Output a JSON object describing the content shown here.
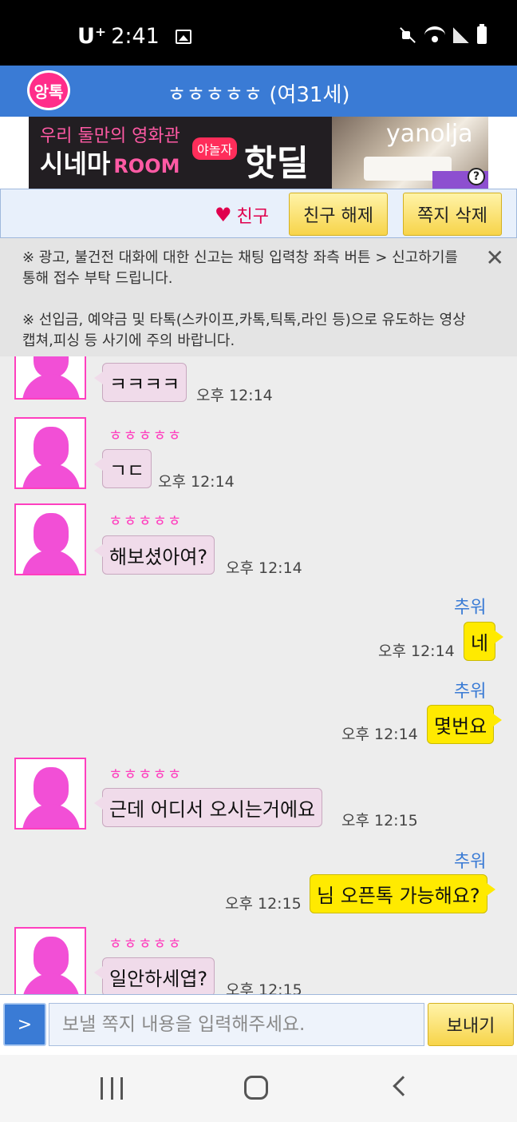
{
  "status_bar": {
    "carrier": "U⁺",
    "time": "2:41"
  },
  "header": {
    "logo": "앙톡",
    "title": "ㅎㅎㅎㅎㅎ (여31세)"
  },
  "banner": {
    "line1": "우리 둘만의 영화관",
    "line2": "시네마",
    "line2_room": "ROOM",
    "tag": "야놀자",
    "deal": "핫딜",
    "brand": "yanolja",
    "help": "?"
  },
  "actions": {
    "friend_label": "친구",
    "unfriend": "친구 해제",
    "delete_note": "쪽지 삭제"
  },
  "notice": {
    "p1": "※ 광고, 불건전 대화에 대한 신고는 채팅 입력창 좌측 버튼 > 신고하기를 통해 접수 부탁 드립니다.",
    "p2": "※ 선입금, 예약금 및 타톡(스카이프,카톡,틱톡,라인 등)으로 유도하는 영상캡쳐,피싱 등 사기에 주의 바랍니다.",
    "close": "✕"
  },
  "messages": [
    {
      "from": "them",
      "sender": "",
      "text": "ㅋㅋㅋㅋ",
      "time": "오후 12:14"
    },
    {
      "from": "them",
      "sender": "ㅎㅎㅎㅎㅎ",
      "text": "ㄱㄷ",
      "time": "오후 12:14"
    },
    {
      "from": "them",
      "sender": "ㅎㅎㅎㅎㅎ",
      "text": "해보셨아여?",
      "time": "오후 12:14"
    },
    {
      "from": "me",
      "sender": "추워",
      "text": "네",
      "time": "오후 12:14"
    },
    {
      "from": "me",
      "sender": "추워",
      "text": "몇번요",
      "time": "오후 12:14"
    },
    {
      "from": "them",
      "sender": "ㅎㅎㅎㅎㅎ",
      "text": "근데 어디서 오시는거에요",
      "time": "오후 12:15"
    },
    {
      "from": "me",
      "sender": "추워",
      "text": "님 오픈톡 가능해요?",
      "time": "오후 12:15"
    },
    {
      "from": "them",
      "sender": "ㅎㅎㅎㅎㅎ",
      "text": "일안하세엽?",
      "time": "오후 12:15"
    }
  ],
  "input": {
    "report_button": ">",
    "placeholder": "보낼 쪽지 내용을 입력해주세요.",
    "send": "보내기"
  },
  "colors": {
    "header": "#3a7bd5",
    "incoming_bubble": "#f0dbea",
    "outgoing_bubble": "#ffea00",
    "sender_pink": "#ff3fbf"
  }
}
